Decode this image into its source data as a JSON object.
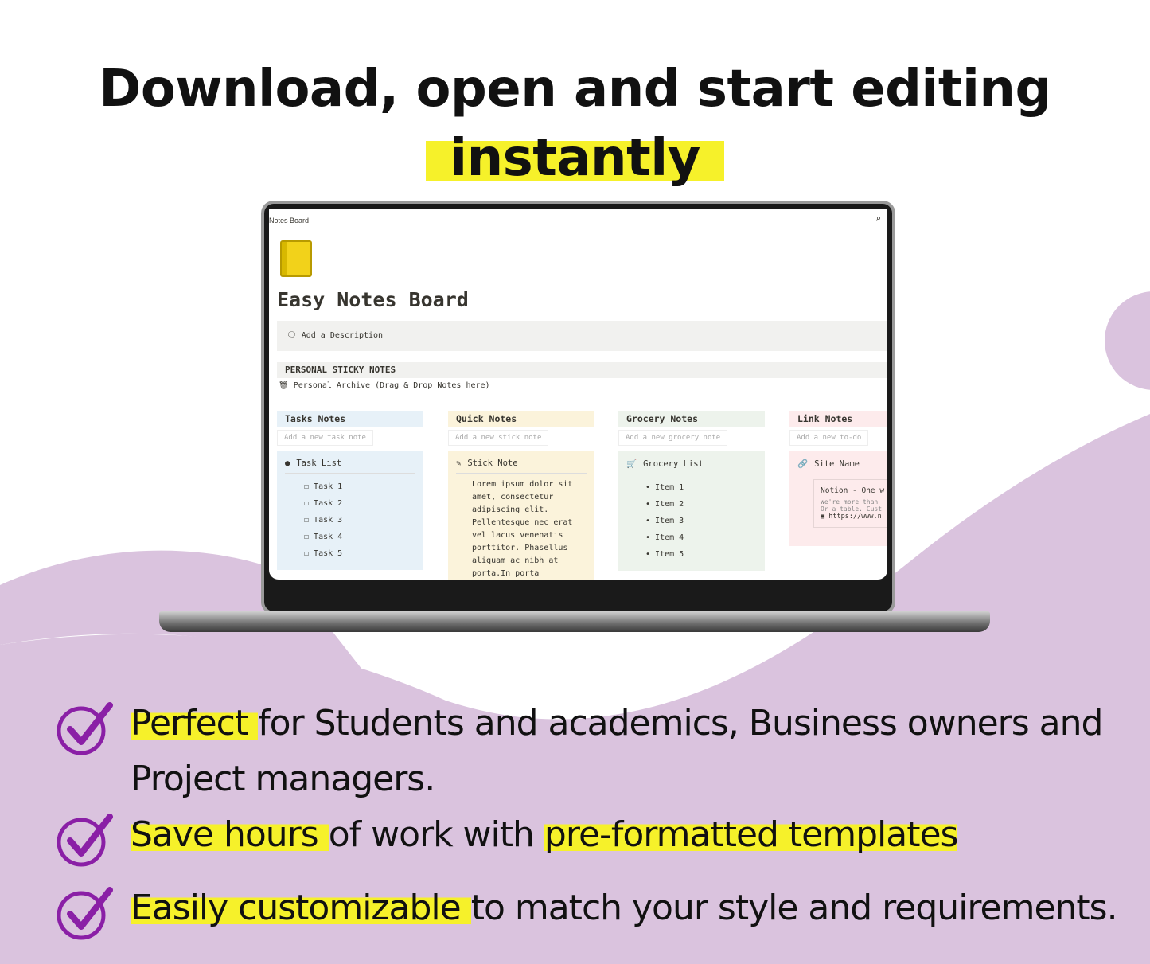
{
  "headline": {
    "line1": "Download, open and start editing",
    "line2": "instantly"
  },
  "colors": {
    "purple": "#dac3de",
    "highlight": "#f6f12a",
    "check": "#8a1fa6"
  },
  "app": {
    "breadcrumb": "Notes Board",
    "page_icon": "notebook-icon",
    "page_title": "Easy Notes Board",
    "description": "Add a Description",
    "section": "PERSONAL STICKY NOTES",
    "archive": "Personal Archive (Drag & Drop Notes here)",
    "columns": [
      {
        "title": "Tasks Notes",
        "add": "Add a new task note",
        "card_title": "Task List",
        "icon": "check-circle-icon",
        "bg": "#e7f1f8",
        "items": [
          "Task 1",
          "Task 2",
          "Task 3",
          "Task 4",
          "Task 5"
        ]
      },
      {
        "title": "Quick Notes",
        "add": "Add a new stick note",
        "card_title": "Stick Note",
        "icon": "pencil-icon",
        "bg": "#fbf3db",
        "text": "Lorem ipsum dolor sit amet, consectetur adipiscing elit. Pellentesque nec erat vel lacus venenatis porttitor. Phasellus aliquam ac nibh at porta.In porta"
      },
      {
        "title": "Grocery Notes",
        "add": "Add a new grocery note",
        "card_title": "Grocery List",
        "icon": "cart-icon",
        "bg": "#edf3ec",
        "items": [
          "Item 1",
          "Item 2",
          "Item 3",
          "Item 4",
          "Item 5"
        ]
      },
      {
        "title": "Link Notes",
        "add": "Add a new to-do",
        "card_title": "Site Name",
        "icon": "link-icon",
        "bg": "#fdebec",
        "bookmark": {
          "title": "Notion - One w",
          "desc1": "We're more than",
          "desc2": "Or a table. Cust",
          "url": "https://www.n"
        }
      }
    ]
  },
  "bullets": [
    {
      "hl": "Perfect ",
      "rest": "for Students and academics, Business owners and",
      "line2": "Project managers."
    },
    {
      "hl": "Save hours ",
      "rest": "of work with ",
      "hl2": "pre-formatted templates"
    },
    {
      "hl": "Easily customizable ",
      "rest": "to match your style and requirements."
    }
  ]
}
